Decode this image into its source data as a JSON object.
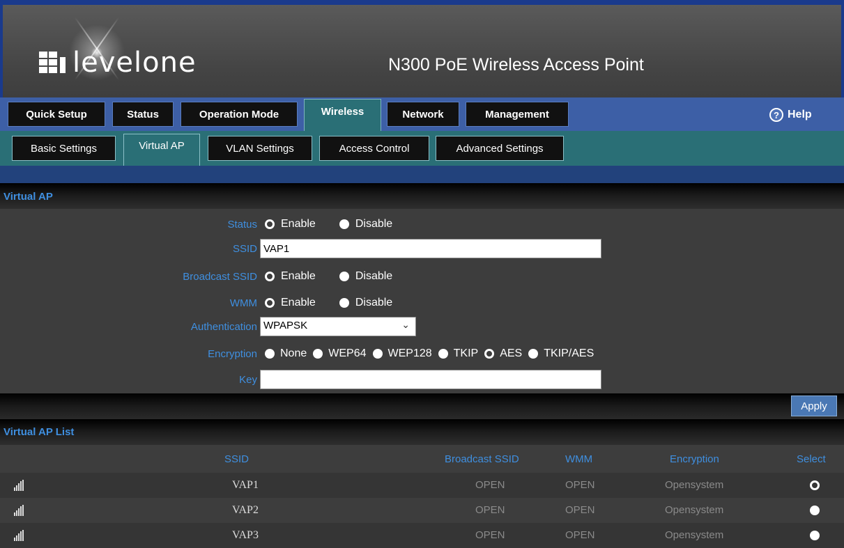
{
  "header": {
    "brand": "levelone",
    "product": "N300 PoE Wireless Access Point"
  },
  "nav": {
    "main_tabs": [
      {
        "label": "Quick Setup"
      },
      {
        "label": "Status"
      },
      {
        "label": "Operation Mode"
      },
      {
        "label": "Wireless",
        "active": true
      },
      {
        "label": "Network"
      },
      {
        "label": "Management"
      }
    ],
    "help_label": "Help",
    "sub_tabs": [
      {
        "label": "Basic Settings"
      },
      {
        "label": "Virtual AP",
        "active": true
      },
      {
        "label": "VLAN Settings"
      },
      {
        "label": "Access Control"
      },
      {
        "label": "Advanced Settings"
      }
    ]
  },
  "form": {
    "section_title": "Virtual AP",
    "status": {
      "label": "Status",
      "enable": "Enable",
      "disable": "Disable",
      "selected": "Enable"
    },
    "ssid": {
      "label": "SSID",
      "value": "VAP1"
    },
    "broadcast": {
      "label": "Broadcast SSID",
      "enable": "Enable",
      "disable": "Disable",
      "selected": "Enable"
    },
    "wmm": {
      "label": "WMM",
      "enable": "Enable",
      "disable": "Disable",
      "selected": "Enable"
    },
    "auth": {
      "label": "Authentication",
      "value": "WPAPSK"
    },
    "encryption": {
      "label": "Encryption",
      "options": [
        "None",
        "WEP64",
        "WEP128",
        "TKIP",
        "AES",
        "TKIP/AES"
      ],
      "selected": "AES"
    },
    "key": {
      "label": "Key",
      "value": ""
    },
    "apply_label": "Apply"
  },
  "list": {
    "section_title": "Virtual AP List",
    "columns": {
      "ssid": "SSID",
      "broadcast": "Broadcast SSID",
      "wmm": "WMM",
      "encryption": "Encryption",
      "select": "Select"
    },
    "rows": [
      {
        "ssid": "VAP1",
        "broadcast": "OPEN",
        "wmm": "OPEN",
        "encryption": "Opensystem",
        "selected": true
      },
      {
        "ssid": "VAP2",
        "broadcast": "OPEN",
        "wmm": "OPEN",
        "encryption": "Opensystem",
        "selected": false
      },
      {
        "ssid": "VAP3",
        "broadcast": "OPEN",
        "wmm": "OPEN",
        "encryption": "Opensystem",
        "selected": false
      }
    ]
  },
  "colors": {
    "accent_label": "#3f8fe0",
    "tab_active": "#2a6f76",
    "nav_bar": "#3d5fa6",
    "apply_button": "#4a78b4"
  }
}
